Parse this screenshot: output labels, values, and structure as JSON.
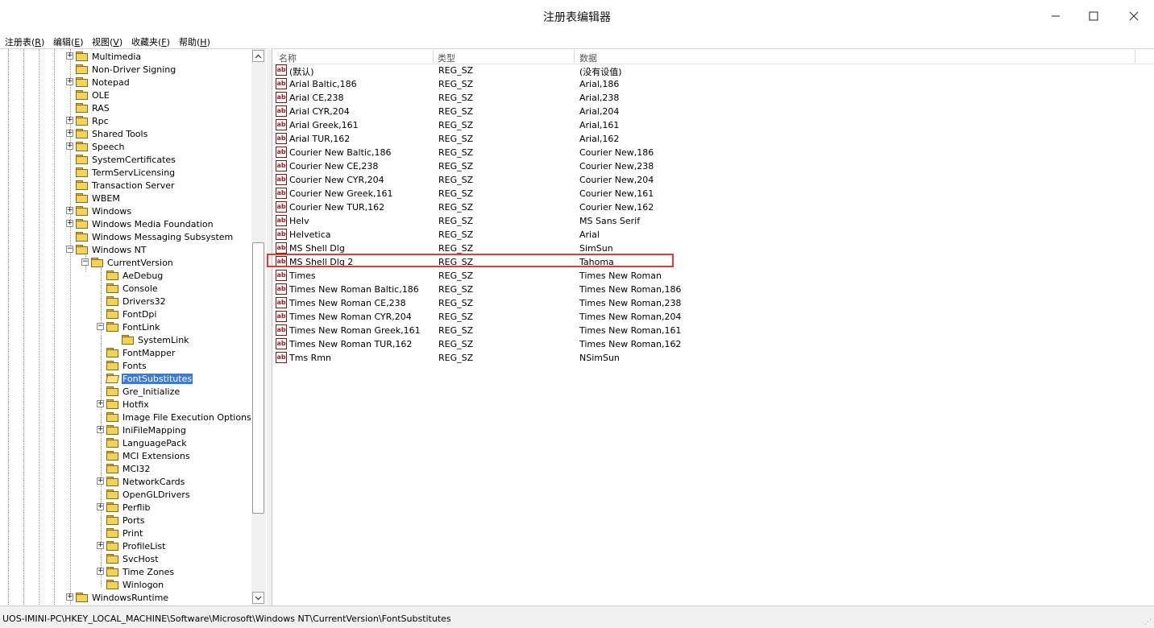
{
  "window": {
    "title": "注册表编辑器",
    "minimize_icon": "minimize-icon",
    "maximize_icon": "maximize-icon",
    "close_icon": "close-icon"
  },
  "menu": [
    {
      "label": "注册表(",
      "key": "R",
      "end": ")"
    },
    {
      "label": "编辑(",
      "key": "E",
      "end": ")"
    },
    {
      "label": "视图(",
      "key": "V",
      "end": ")"
    },
    {
      "label": "收藏夹(",
      "key": "F",
      "end": ")"
    },
    {
      "label": "帮助(",
      "key": "H",
      "end": ")"
    }
  ],
  "tree": {
    "items": [
      {
        "label": "Multimedia",
        "level": 1,
        "expander": "+"
      },
      {
        "label": "Non-Driver Signing",
        "level": 1,
        "expander": ""
      },
      {
        "label": "Notepad",
        "level": 1,
        "expander": "+"
      },
      {
        "label": "OLE",
        "level": 1,
        "expander": ""
      },
      {
        "label": "RAS",
        "level": 1,
        "expander": ""
      },
      {
        "label": "Rpc",
        "level": 1,
        "expander": "+"
      },
      {
        "label": "Shared Tools",
        "level": 1,
        "expander": "+"
      },
      {
        "label": "Speech",
        "level": 1,
        "expander": "+"
      },
      {
        "label": "SystemCertificates",
        "level": 1,
        "expander": ""
      },
      {
        "label": "TermServLicensing",
        "level": 1,
        "expander": ""
      },
      {
        "label": "Transaction Server",
        "level": 1,
        "expander": ""
      },
      {
        "label": "WBEM",
        "level": 1,
        "expander": ""
      },
      {
        "label": "Windows",
        "level": 1,
        "expander": "+"
      },
      {
        "label": "Windows Media Foundation",
        "level": 1,
        "expander": "+"
      },
      {
        "label": "Windows Messaging Subsystem",
        "level": 1,
        "expander": ""
      },
      {
        "label": "Windows NT",
        "level": 1,
        "expander": "−"
      },
      {
        "label": "CurrentVersion",
        "level": 2,
        "expander": "−"
      },
      {
        "label": "AeDebug",
        "level": 3,
        "expander": ""
      },
      {
        "label": "Console",
        "level": 3,
        "expander": ""
      },
      {
        "label": "Drivers32",
        "level": 3,
        "expander": ""
      },
      {
        "label": "FontDpi",
        "level": 3,
        "expander": ""
      },
      {
        "label": "FontLink",
        "level": 3,
        "expander": "−"
      },
      {
        "label": "SystemLink",
        "level": 4,
        "expander": ""
      },
      {
        "label": "FontMapper",
        "level": 3,
        "expander": ""
      },
      {
        "label": "Fonts",
        "level": 3,
        "expander": ""
      },
      {
        "label": "FontSubstitutes",
        "level": 3,
        "expander": "",
        "selected": true
      },
      {
        "label": "Gre_Initialize",
        "level": 3,
        "expander": ""
      },
      {
        "label": "Hotfix",
        "level": 3,
        "expander": "+"
      },
      {
        "label": "Image File Execution Options",
        "level": 3,
        "expander": ""
      },
      {
        "label": "IniFileMapping",
        "level": 3,
        "expander": "+"
      },
      {
        "label": "LanguagePack",
        "level": 3,
        "expander": ""
      },
      {
        "label": "MCI Extensions",
        "level": 3,
        "expander": ""
      },
      {
        "label": "MCI32",
        "level": 3,
        "expander": ""
      },
      {
        "label": "NetworkCards",
        "level": 3,
        "expander": "+"
      },
      {
        "label": "OpenGLDrivers",
        "level": 3,
        "expander": ""
      },
      {
        "label": "Perflib",
        "level": 3,
        "expander": "+"
      },
      {
        "label": "Ports",
        "level": 3,
        "expander": ""
      },
      {
        "label": "Print",
        "level": 3,
        "expander": ""
      },
      {
        "label": "ProfileList",
        "level": 3,
        "expander": "+"
      },
      {
        "label": "SvcHost",
        "level": 3,
        "expander": ""
      },
      {
        "label": "Time Zones",
        "level": 3,
        "expander": "+"
      },
      {
        "label": "Winlogon",
        "level": 3,
        "expander": ""
      },
      {
        "label": "WindowsRuntime",
        "level": 1,
        "expander": "+"
      }
    ]
  },
  "list": {
    "columns": [
      "名称",
      "类型",
      "数据"
    ],
    "icon": "string-value-icon",
    "icon_text": "ab",
    "rows": [
      {
        "name": "(默认)",
        "type": "REG_SZ",
        "data": "(没有设值)"
      },
      {
        "name": "Arial Baltic,186",
        "type": "REG_SZ",
        "data": "Arial,186"
      },
      {
        "name": "Arial CE,238",
        "type": "REG_SZ",
        "data": "Arial,238"
      },
      {
        "name": "Arial CYR,204",
        "type": "REG_SZ",
        "data": "Arial,204"
      },
      {
        "name": "Arial Greek,161",
        "type": "REG_SZ",
        "data": "Arial,161"
      },
      {
        "name": "Arial TUR,162",
        "type": "REG_SZ",
        "data": "Arial,162"
      },
      {
        "name": "Courier New Baltic,186",
        "type": "REG_SZ",
        "data": "Courier New,186"
      },
      {
        "name": "Courier New CE,238",
        "type": "REG_SZ",
        "data": "Courier New,238"
      },
      {
        "name": "Courier New CYR,204",
        "type": "REG_SZ",
        "data": "Courier New,204"
      },
      {
        "name": "Courier New Greek,161",
        "type": "REG_SZ",
        "data": "Courier New,161"
      },
      {
        "name": "Courier New TUR,162",
        "type": "REG_SZ",
        "data": "Courier New,162"
      },
      {
        "name": "Helv",
        "type": "REG_SZ",
        "data": "MS Sans Serif"
      },
      {
        "name": "Helvetica",
        "type": "REG_SZ",
        "data": "Arial"
      },
      {
        "name": "MS Shell Dlg",
        "type": "REG_SZ",
        "data": "SimSun"
      },
      {
        "name": "MS Shell Dlg 2",
        "type": "REG_SZ",
        "data": "Tahoma",
        "highlighted": true
      },
      {
        "name": "Times",
        "type": "REG_SZ",
        "data": "Times New Roman"
      },
      {
        "name": "Times New Roman Baltic,186",
        "type": "REG_SZ",
        "data": "Times New Roman,186"
      },
      {
        "name": "Times New Roman CE,238",
        "type": "REG_SZ",
        "data": "Times New Roman,238"
      },
      {
        "name": "Times New Roman CYR,204",
        "type": "REG_SZ",
        "data": "Times New Roman,204"
      },
      {
        "name": "Times New Roman Greek,161",
        "type": "REG_SZ",
        "data": "Times New Roman,161"
      },
      {
        "name": "Times New Roman TUR,162",
        "type": "REG_SZ",
        "data": "Times New Roman,162"
      },
      {
        "name": "Tms Rmn",
        "type": "REG_SZ",
        "data": "NSimSun"
      }
    ]
  },
  "status": {
    "path": "UOS-IMINI-PC\\HKEY_LOCAL_MACHINE\\Software\\Microsoft\\Windows NT\\CurrentVersion\\FontSubstitutes"
  },
  "colors": {
    "selection": "#3a7bd5",
    "highlight_box": "#e53935",
    "folder": "#f2d35a"
  }
}
